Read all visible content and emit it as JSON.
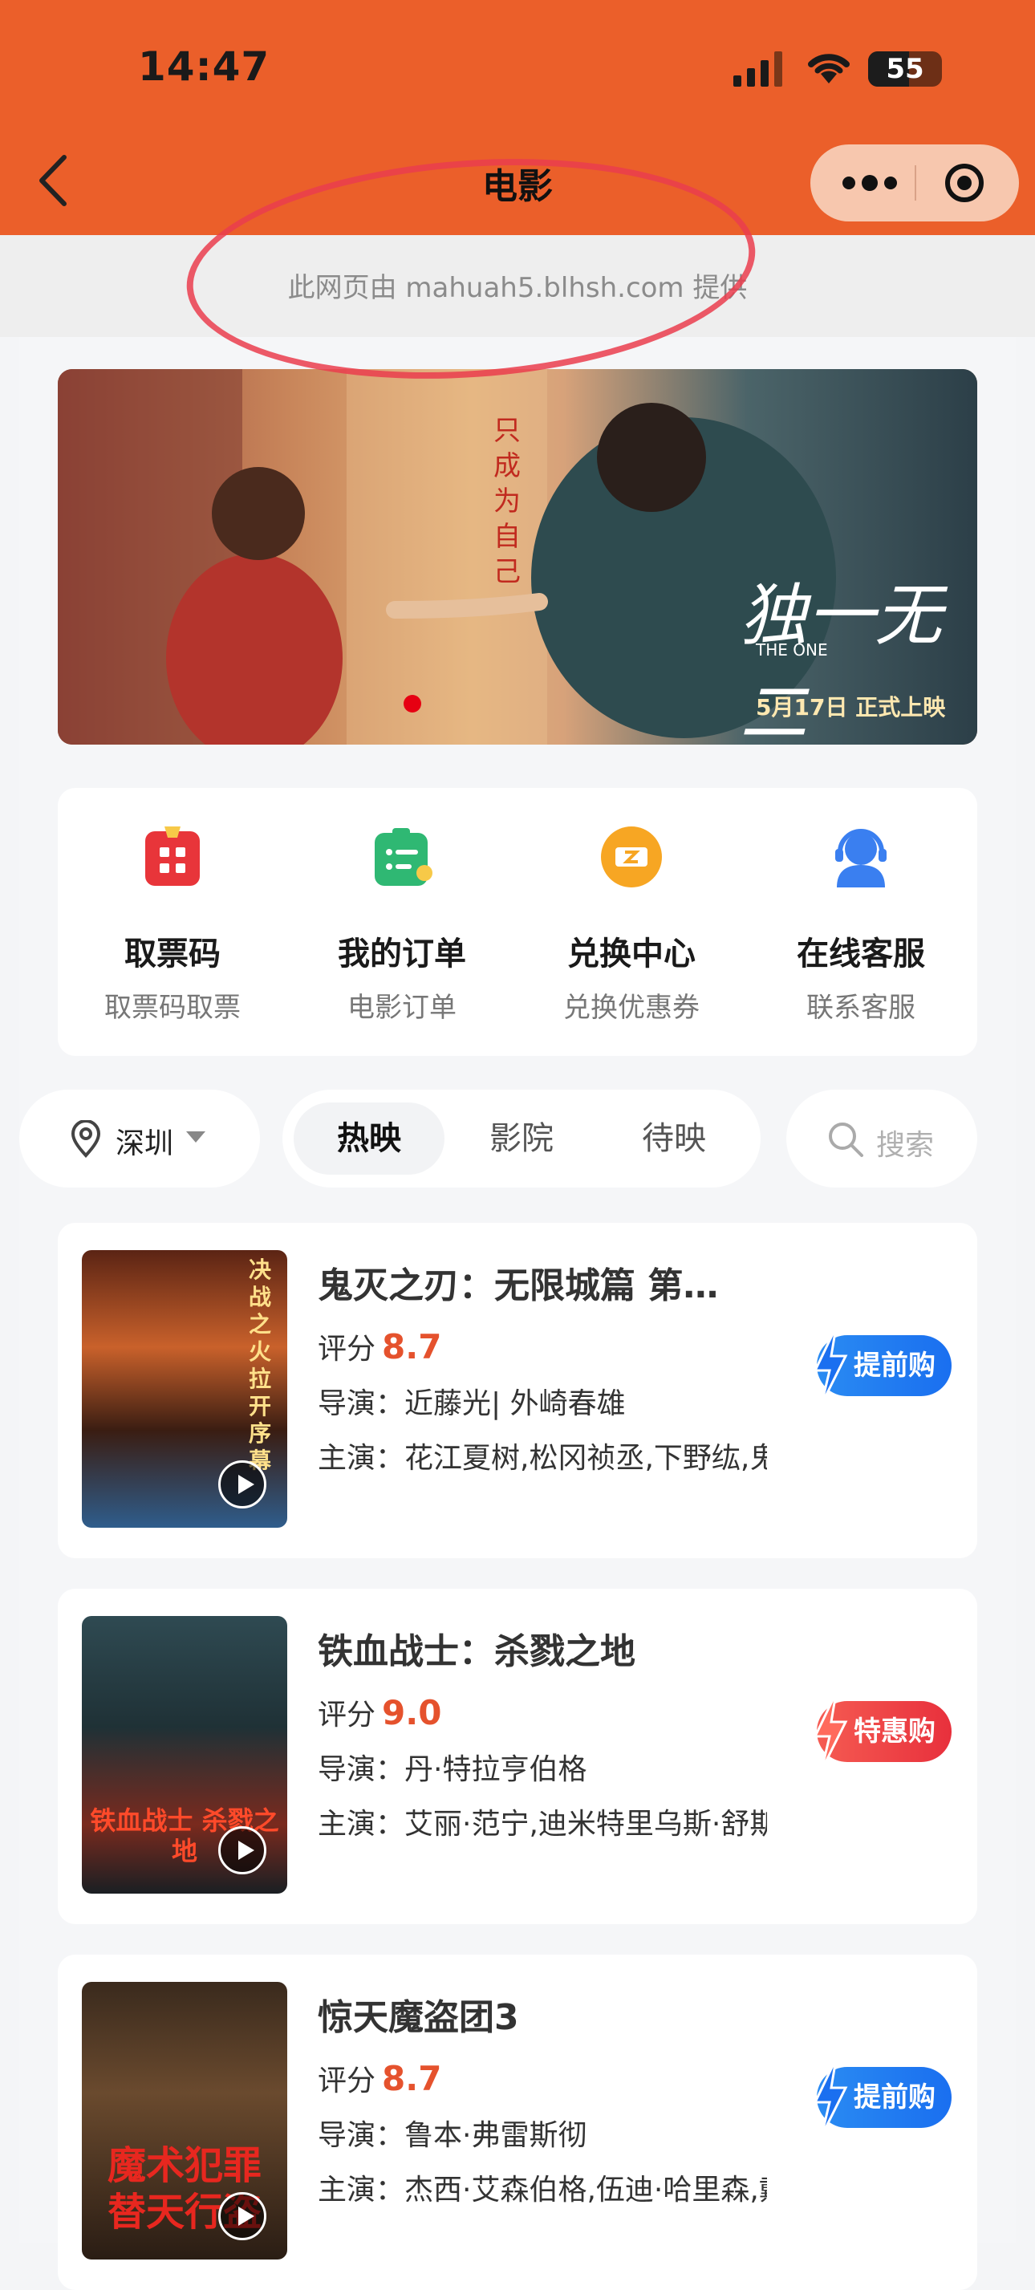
{
  "status_bar": {
    "time": "14:47",
    "battery": "55",
    "battery_level": 0.55
  },
  "nav": {
    "title": "电影"
  },
  "notice": {
    "text": "此网页由 mahuah5.blhsh.com 提供"
  },
  "banner": {
    "vertical_text": "只成为自己",
    "title": "独一无二",
    "subtitle": "THE ONE",
    "date_text": "5月17日 正式上映"
  },
  "quick_entries": [
    {
      "name": "取票码",
      "sub": "取票码取票",
      "icon": "ticket-code-icon",
      "color": "#e8353a"
    },
    {
      "name": "我的订单",
      "sub": "电影订单",
      "icon": "order-list-icon",
      "color": "#2fb873"
    },
    {
      "name": "兑换中心",
      "sub": "兑换优惠券",
      "icon": "coupon-icon",
      "color": "#f7a623"
    },
    {
      "name": "在线客服",
      "sub": "联系客服",
      "icon": "customer-service-icon",
      "color": "#3a7ff0"
    }
  ],
  "filters": {
    "city": "深圳",
    "tabs": [
      "热映",
      "影院",
      "待映"
    ],
    "active_tab": "热映",
    "search_placeholder": "搜索"
  },
  "movies": [
    {
      "title": "鬼灭之刃：无限城篇 第…",
      "score_label": "评分",
      "score": "8.7",
      "director_label": "导演：",
      "director": "近藤光| 外崎春雄",
      "cast_label": "主演：",
      "cast": "花江夏树,松冈祯丞,下野纮,鬼头",
      "action": "提前购",
      "action_color": "blue",
      "poster_caption": "决战之火 拉开序幕"
    },
    {
      "title": "铁血战士：杀戮之地",
      "score_label": "评分",
      "score": "9.0",
      "director_label": "导演：",
      "director": "丹·特拉亨伯格",
      "cast_label": "主演：",
      "cast": "艾丽·范宁,迪米特里乌斯·舒斯",
      "action": "特惠购",
      "action_color": "red",
      "poster_caption": "铁血战士 杀戮之地"
    },
    {
      "title": "惊天魔盗团3",
      "score_label": "评分",
      "score": "8.7",
      "director_label": "导演：",
      "director": "鲁本·弗雷斯彻",
      "cast_label": "主演：",
      "cast": "杰西·艾森伯格,伍迪·哈里森,戴",
      "action": "提前购",
      "action_color": "blue",
      "poster_caption": "魔术犯罪 替天行盗"
    }
  ],
  "colors": {
    "brand": "#eb5f2a",
    "score": "#e5522d",
    "annotation_circle": "#ea3d4e"
  }
}
